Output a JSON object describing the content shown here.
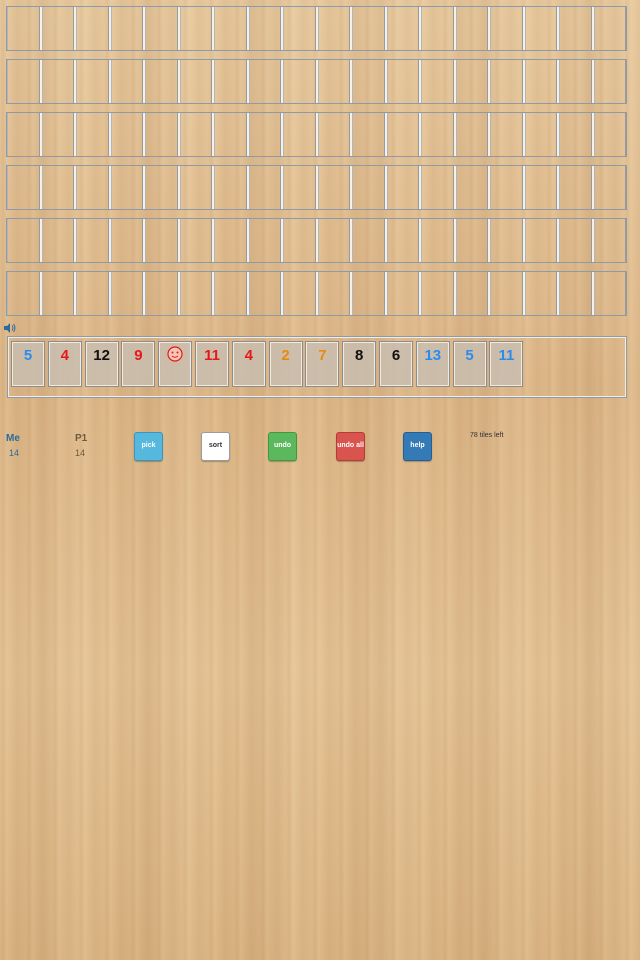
{
  "board": {
    "rows": 6,
    "columns": 18
  },
  "sound_icon": "speaker-icon",
  "rack": {
    "tiles": [
      {
        "value": "5",
        "color": "#2a8cf0"
      },
      {
        "value": "4",
        "color": "#e81818"
      },
      {
        "value": "12",
        "color": "#111111"
      },
      {
        "value": "9",
        "color": "#e81818"
      },
      {
        "value": "",
        "color": "#e81818",
        "joker": true,
        "icon": "joker-smiley-icon"
      },
      {
        "value": "11",
        "color": "#e81818"
      },
      {
        "value": "4",
        "color": "#e81818"
      },
      {
        "value": "2",
        "color": "#e88a10"
      },
      {
        "value": "7",
        "color": "#e88a10"
      },
      {
        "value": "8",
        "color": "#111111"
      },
      {
        "value": "6",
        "color": "#111111"
      },
      {
        "value": "13",
        "color": "#2a8cf0"
      },
      {
        "value": "5",
        "color": "#2a8cf0"
      },
      {
        "value": "11",
        "color": "#2a8cf0"
      }
    ]
  },
  "players": [
    {
      "name": "Me",
      "count": "14",
      "color": "#2d6b9a"
    },
    {
      "name": "P1",
      "count": "14",
      "color": "#6e5a3e"
    }
  ],
  "buttons": {
    "pick": "pick",
    "sort": "sort",
    "undo": "undo",
    "undo_all": "undo all",
    "help": "help"
  },
  "tiles_left": "78 tiles left"
}
